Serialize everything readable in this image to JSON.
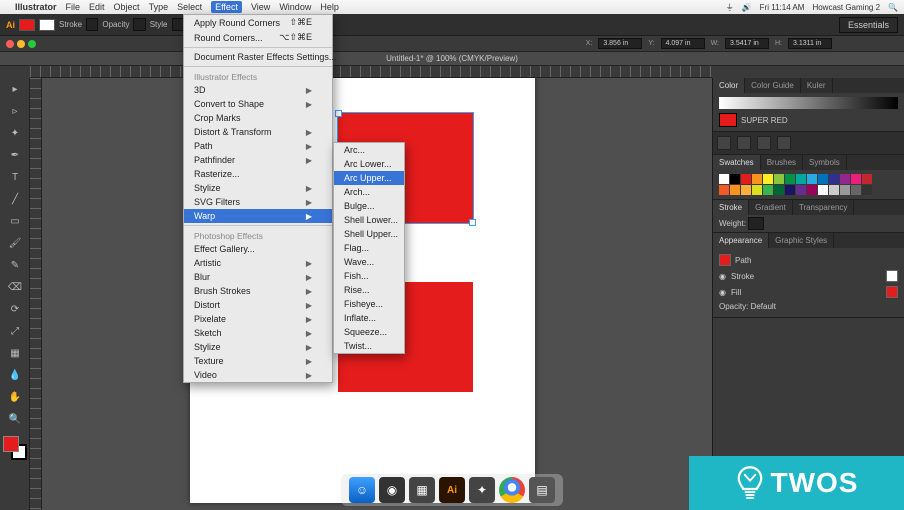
{
  "mac_menu": {
    "app": "Illustrator",
    "items": [
      "File",
      "Edit",
      "Object",
      "Type",
      "Select",
      "Effect",
      "View",
      "Window",
      "Help"
    ],
    "active": "Effect",
    "status_right": [
      "Fri 11:14 AM",
      "Howcast Gaming 2"
    ]
  },
  "app_bar": {
    "stroke_label": "Stroke",
    "opacity_label": "Opacity",
    "style_label": "Style",
    "essentials": "Essentials"
  },
  "control_bar": {
    "x_label": "X:",
    "x_val": "3.856 in",
    "y_label": "Y:",
    "y_val": "4.097 in",
    "w_label": "W:",
    "w_val": "3.5417 in",
    "h_label": "H:",
    "h_val": "3.1311 in"
  },
  "doc_tab": {
    "title": "Untitled-1* @ 100% (CMYK/Preview)"
  },
  "effect_menu": {
    "top": [
      {
        "label": "Apply Round Corners",
        "shortcut": "⇧⌘E"
      },
      {
        "label": "Round Corners...",
        "shortcut": "⌥⇧⌘E"
      }
    ],
    "doc_raster": "Document Raster Effects Settings...",
    "heading1": "Illustrator Effects",
    "group1": [
      "3D",
      "Convert to Shape",
      "Crop Marks",
      "Distort & Transform",
      "Path",
      "Pathfinder",
      "Rasterize...",
      "Stylize",
      "SVG Filters",
      "Warp"
    ],
    "heading2": "Photoshop Effects",
    "group2": [
      "Effect Gallery...",
      "Artistic",
      "Blur",
      "Brush Strokes",
      "Distort",
      "Pixelate",
      "Sketch",
      "Stylize",
      "Texture",
      "Video"
    ],
    "highlighted": "Warp"
  },
  "warp_menu": {
    "items": [
      "Arc...",
      "Arc Lower...",
      "Arc Upper...",
      "Arch...",
      "Bulge...",
      "Shell Lower...",
      "Shell Upper...",
      "Flag...",
      "Wave...",
      "Fish...",
      "Rise...",
      "Fisheye...",
      "Inflate...",
      "Squeeze...",
      "Twist..."
    ],
    "highlighted": "Arc Upper..."
  },
  "panels": {
    "color_tabs": [
      "Color",
      "Color Guide",
      "Kuler"
    ],
    "super_red": "SUPER RED",
    "swatch_tabs": [
      "Swatches",
      "Brushes",
      "Symbols"
    ],
    "stroke_tabs": [
      "Stroke",
      "Gradient",
      "Transparency"
    ],
    "stroke_weight_label": "Weight:",
    "appearance_tabs": [
      "Appearance",
      "Graphic Styles"
    ],
    "appearance": {
      "obj": "Path",
      "rows": [
        {
          "label": "Stroke",
          "sw": "#ffffff"
        },
        {
          "label": "Fill",
          "sw": "#e51c1c"
        },
        {
          "label": "Opacity: Default",
          "sw": null
        }
      ]
    }
  },
  "watermark": {
    "text": "TWOS"
  },
  "swatch_colors": [
    "#ffffff",
    "#000000",
    "#e51c1c",
    "#f7931e",
    "#fcee21",
    "#8cc63f",
    "#009245",
    "#00a99d",
    "#29abe2",
    "#0071bc",
    "#2e3192",
    "#93278f",
    "#ed1e79",
    "#c1272d",
    "#f15a24",
    "#f7931e",
    "#fbb03b",
    "#d9e021",
    "#39b54a",
    "#006837",
    "#1b1464",
    "#662d91",
    "#9e005d",
    "#ffffff",
    "#cccccc",
    "#999999",
    "#666666",
    "#333333"
  ]
}
